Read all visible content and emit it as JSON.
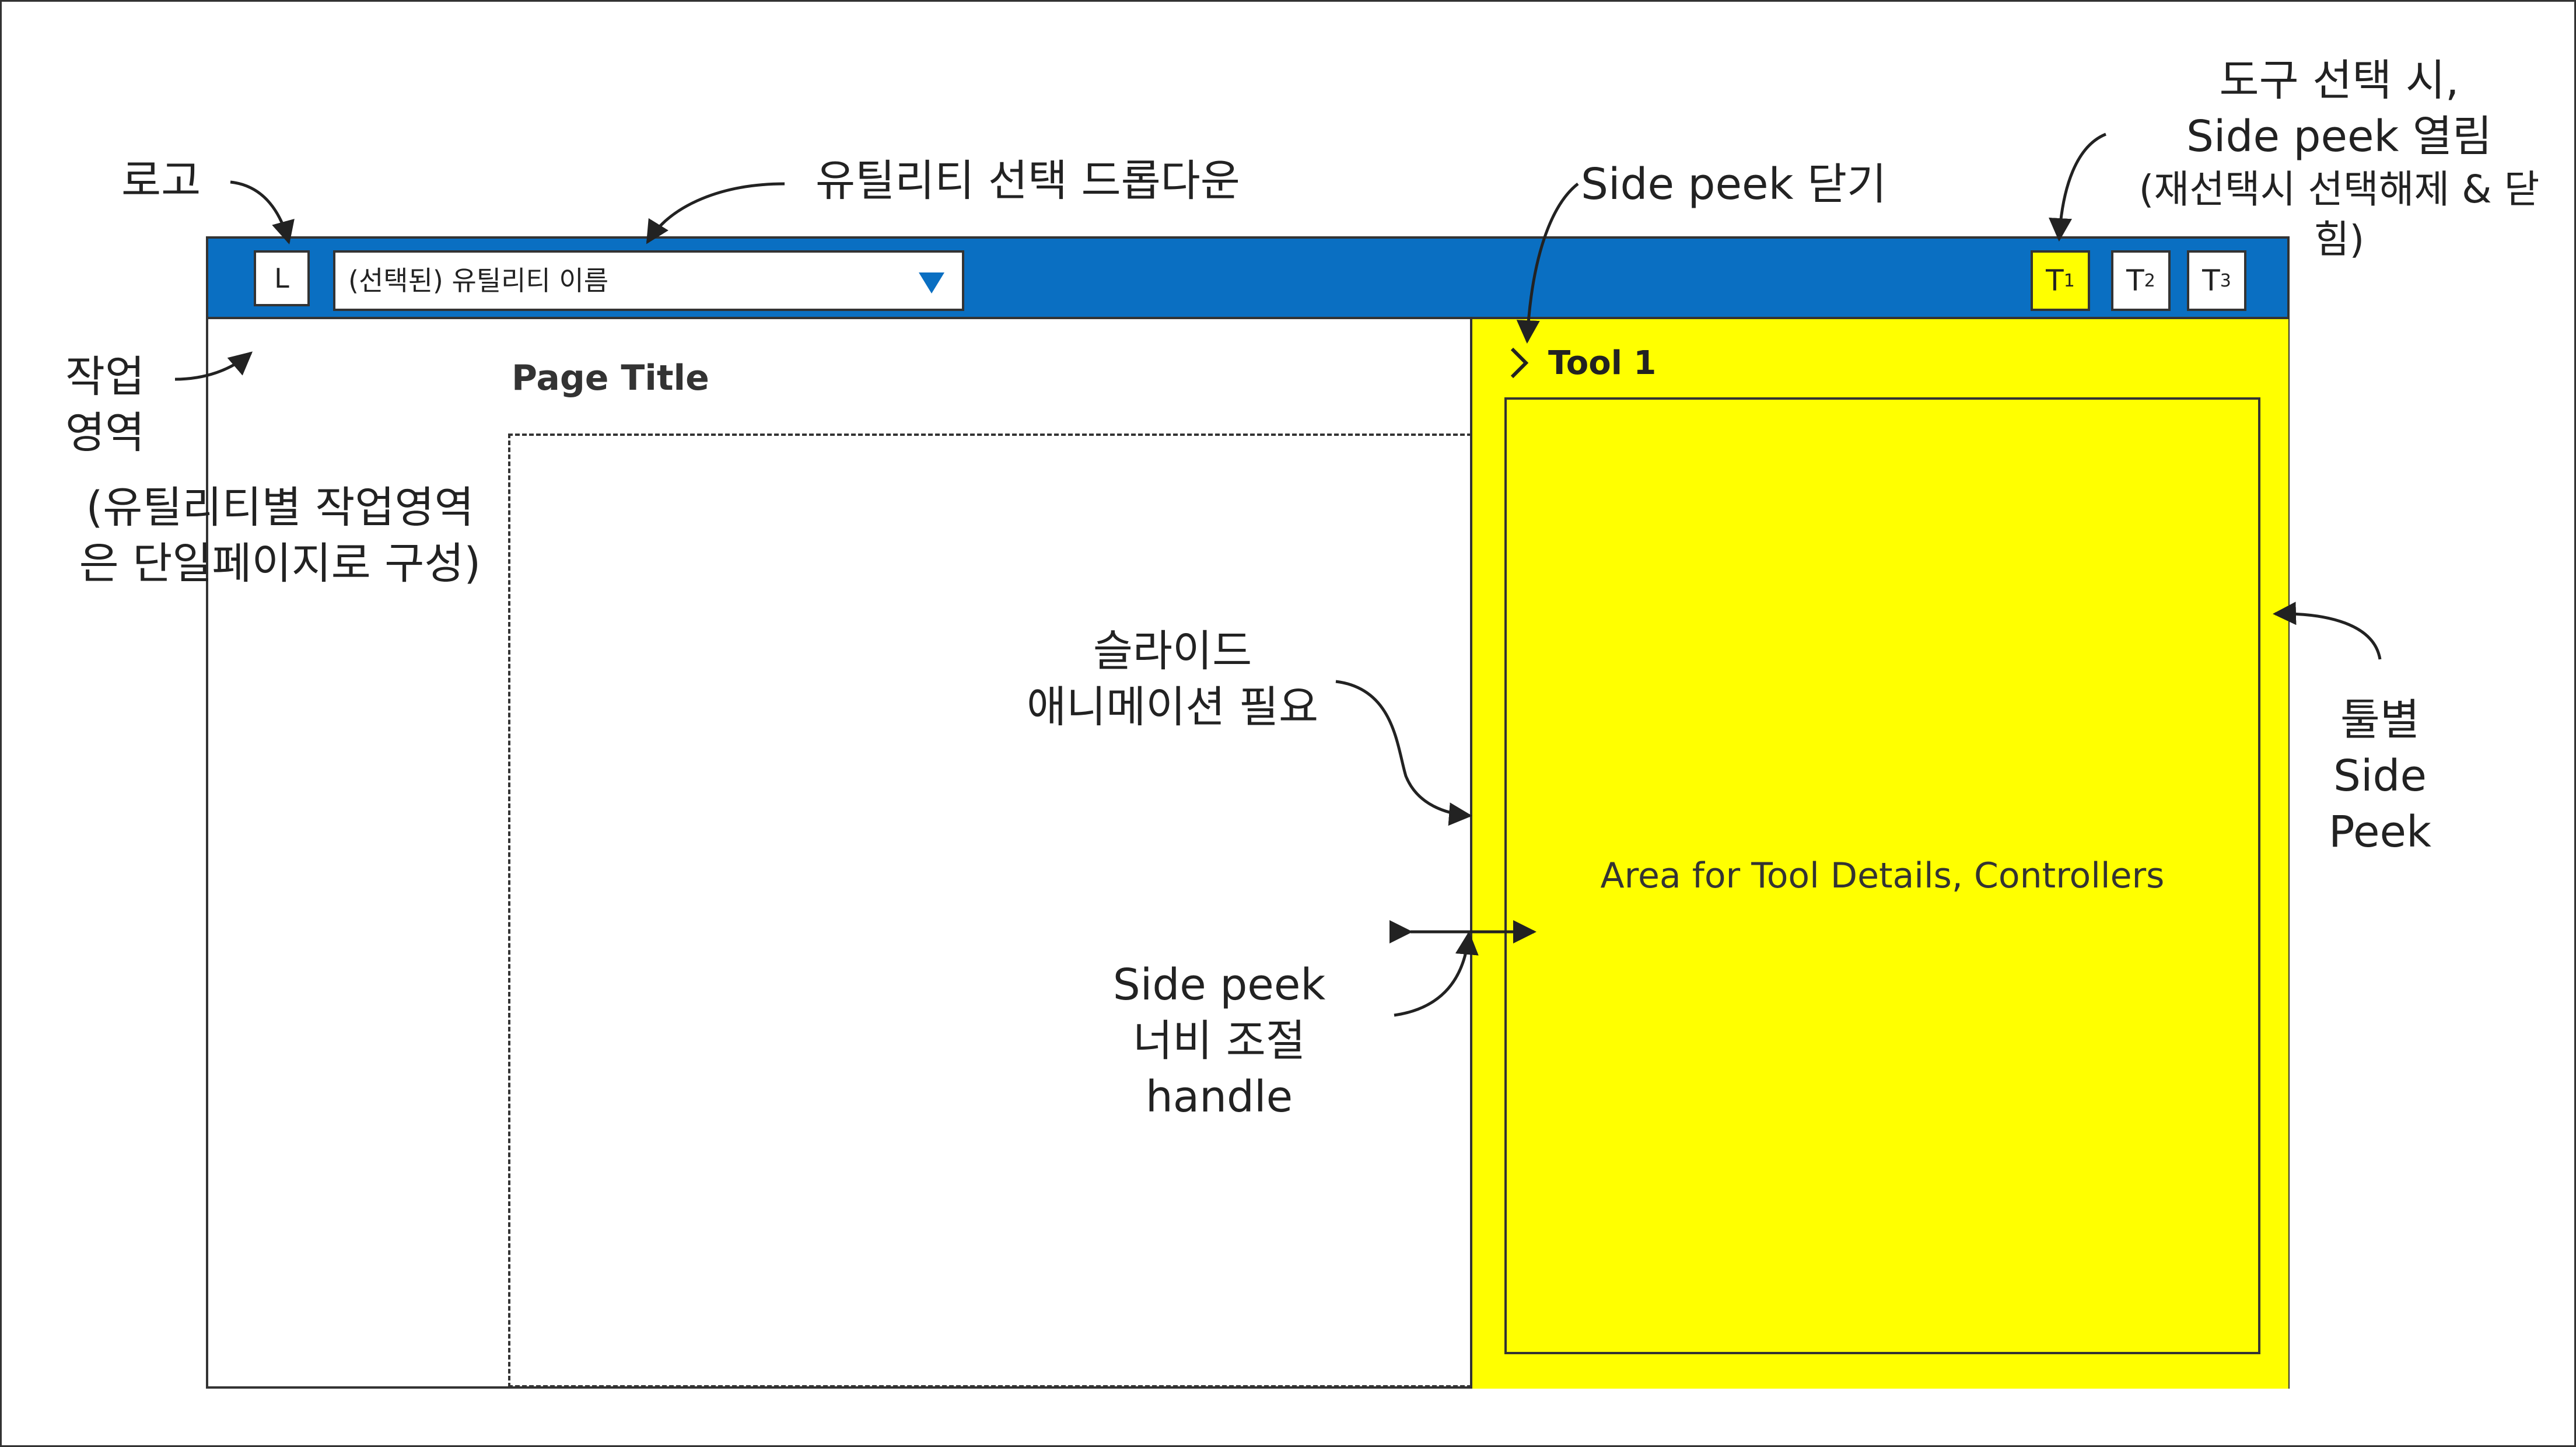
{
  "topbar": {
    "logo_label": "L",
    "dropdown": {
      "selected": "(선택된) 유틸리티 이름"
    },
    "tools": [
      {
        "label": "T",
        "sub": "1",
        "active": true
      },
      {
        "label": "T",
        "sub": "2",
        "active": false
      },
      {
        "label": "T",
        "sub": "3",
        "active": false
      }
    ],
    "colors": {
      "bar": "#0a6fc2",
      "active_tool": "#ffff00"
    }
  },
  "main": {
    "page_title": "Page Title"
  },
  "sidepeek": {
    "title": "Tool 1",
    "body_text": "Area for Tool Details, Controllers",
    "background": "#ffff00"
  },
  "annotations": {
    "logo": "로고",
    "dropdown": "유틸리티 선택 드롭다운",
    "close": "Side peek 닫기",
    "tool_select_1": "도구 선택 시,",
    "tool_select_2": "Side peek 열림",
    "tool_select_3": "(재선택시 선택해제 & 닫힘)",
    "work_1": "작업",
    "work_2": "영역",
    "work_3": "(유틸리티별 작업영역",
    "work_4": "은 단일페이지로 구성)",
    "slide_1": "슬라이드",
    "slide_2": "애니메이션 필요",
    "width_1": "Side peek",
    "width_2": "너비 조절 handle",
    "perpeek_1": "툴별",
    "perpeek_2": "Side",
    "perpeek_3": "Peek"
  },
  "icons": {
    "dropdown_caret": "caret-down-icon",
    "peek_close": "chevron-right-icon",
    "resize": "double-arrow-icon"
  }
}
